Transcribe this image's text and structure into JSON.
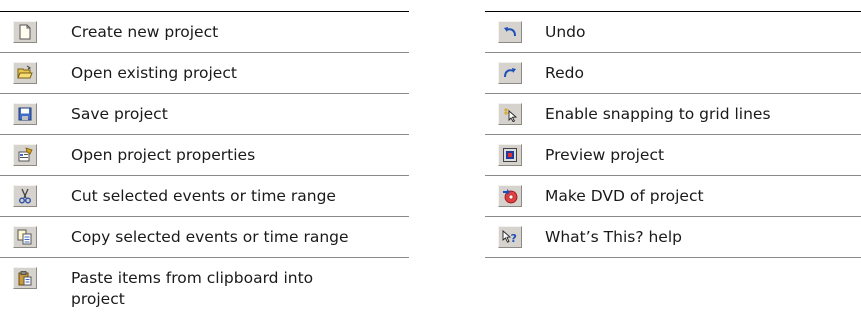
{
  "left_items": [
    {
      "label": "Create new project",
      "icon": "new-document-icon"
    },
    {
      "label": "Open existing project",
      "icon": "open-folder-icon"
    },
    {
      "label": "Save project",
      "icon": "save-floppy-icon"
    },
    {
      "label": "Open project properties",
      "icon": "properties-icon"
    },
    {
      "label": "Cut selected events or time range",
      "icon": "cut-scissors-icon"
    },
    {
      "label": "Copy selected events or time range",
      "icon": "copy-icon"
    },
    {
      "label": "Paste items from clipboard into project",
      "icon": "paste-clipboard-icon"
    }
  ],
  "right_items": [
    {
      "label": "Undo",
      "icon": "undo-icon"
    },
    {
      "label": "Redo",
      "icon": "redo-icon"
    },
    {
      "label": "Enable snapping to grid lines",
      "icon": "snap-grid-icon"
    },
    {
      "label": "Preview project",
      "icon": "preview-monitor-icon"
    },
    {
      "label": "Make DVD of project",
      "icon": "make-dvd-icon"
    },
    {
      "label": "What’s This? help",
      "icon": "whats-this-help-icon"
    }
  ]
}
